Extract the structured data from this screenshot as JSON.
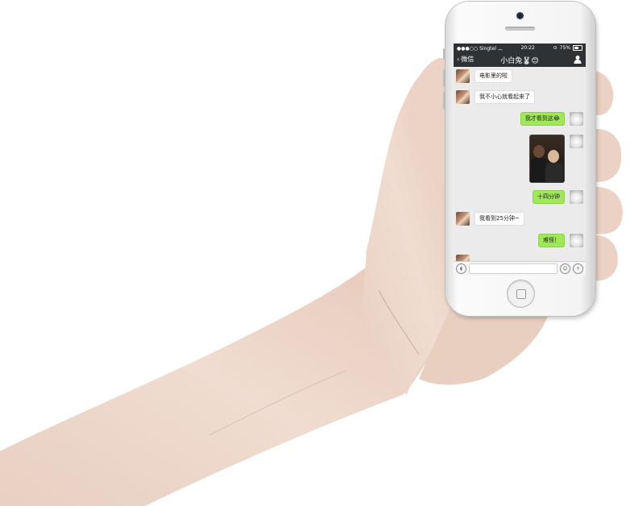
{
  "status_bar": {
    "carrier": "Singtel",
    "time": "20:22",
    "battery": "75%"
  },
  "nav": {
    "back_label": "微信",
    "title": "小白兔🐰😊"
  },
  "messages": [
    {
      "side": "in",
      "text": "电影里的啦"
    },
    {
      "side": "in",
      "text": "我不小心就看起来了"
    },
    {
      "side": "out",
      "text": "我才看到这😂"
    },
    {
      "side": "out",
      "text": ""
    },
    {
      "side": "out",
      "text": "十四分钟"
    },
    {
      "side": "in",
      "text": "我看到25分钟~"
    },
    {
      "side": "out",
      "text": "难怪！"
    }
  ],
  "input_bar": {
    "voice_icon": "voice-icon",
    "emoji_icon": "emoji-icon",
    "plus_icon": "plus-icon"
  },
  "colors": {
    "nav_bg": "#2f3235",
    "chat_bg": "#ebebeb",
    "out_bubble": "#a0e759",
    "in_bubble": "#ffffff"
  }
}
